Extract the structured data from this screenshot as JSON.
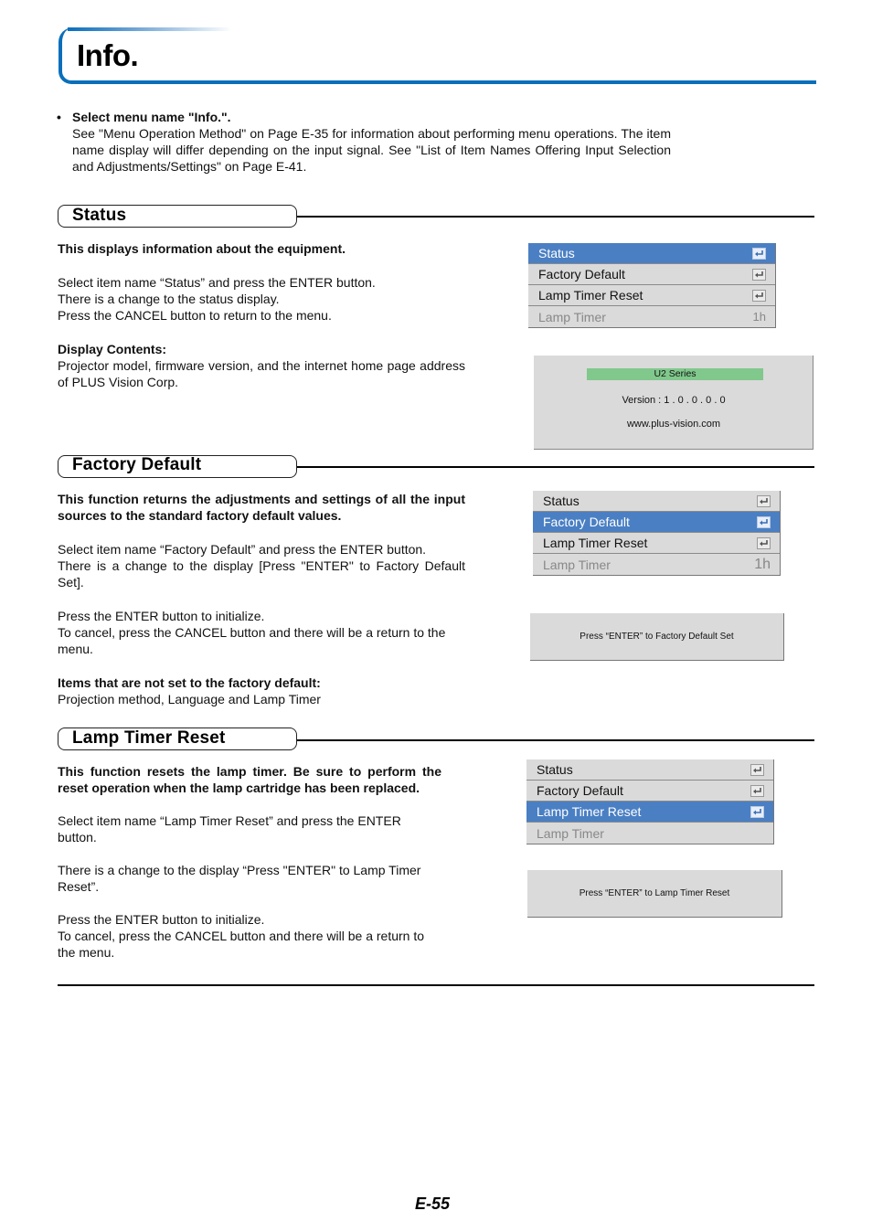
{
  "page": {
    "title": "Info.",
    "page_number": "E-55"
  },
  "intro": {
    "bullet": "•",
    "heading": "Select menu name \"Info.\".",
    "body": "See \"Menu Operation Method\" on Page E-35 for information about performing menu operations. The item name display will differ depending on the input signal. See \"List of Item Names Offering Input Selection and Adjustments/Settings\" on Page E-41."
  },
  "menu_items": {
    "status": "Status",
    "factory_default": "Factory Default",
    "lamp_timer_reset": "Lamp Timer Reset",
    "lamp_timer": "Lamp Timer",
    "lamp_timer_value": "1h",
    "enter_icon": "enter-return-icon"
  },
  "sections": {
    "status": {
      "title": "Status",
      "lead": "This displays information about the equipment.",
      "p1": "Select item name “Status” and press the ENTER button.",
      "p2": "There is a change to the status display.",
      "p3": "Press the CANCEL button to return to the menu.",
      "contents_label": "Display Contents:",
      "contents_text": "Projector model, firmware version, and the internet home page address of PLUS Vision Corp.",
      "selected_item": "Status",
      "status_display": {
        "series": "U2 Series",
        "version": "Version : 1 . 0 . 0 . 0 . 0",
        "url": "www.plus-vision.com"
      }
    },
    "factory_default": {
      "title": "Factory Default",
      "lead": "This function returns the adjustments and settings of all the input sources to the standard factory default values.",
      "p1": "Select item name “Factory Default” and press the ENTER button.",
      "p2": "There is a change to the display [Press \"ENTER\" to Factory Default Set].",
      "p3": "Press the ENTER button to initialize.",
      "p4": "To cancel, press the CANCEL button and there will be a return to the menu.",
      "not_set_label": "Items that are not set to the factory default:",
      "not_set_text": "Projection method, Language and Lamp Timer",
      "selected_item": "Factory Default",
      "prompt": "Press “ENTER” to Factory Default Set"
    },
    "lamp_timer_reset": {
      "title": "Lamp Timer Reset",
      "lead": "This function resets the lamp timer. Be sure to perform the reset operation when the lamp cartridge has been replaced.",
      "p1": "Select item name “Lamp Timer Reset” and press the ENTER button.",
      "p2": "There is a change to the display “Press \"ENTER\" to Lamp Timer Reset”.",
      "p3": "Press the ENTER button to initialize.",
      "p4": "To cancel, press the CANCEL button and there will be a return to the menu.",
      "selected_item": "Lamp Timer Reset",
      "prompt": "Press “ENTER” to Lamp Timer Reset"
    }
  },
  "colors": {
    "title_accent": "#0a6fbb",
    "menu_selected": "#4a7fc3",
    "menu_background": "#dadada",
    "series_bar": "#80c88c"
  }
}
